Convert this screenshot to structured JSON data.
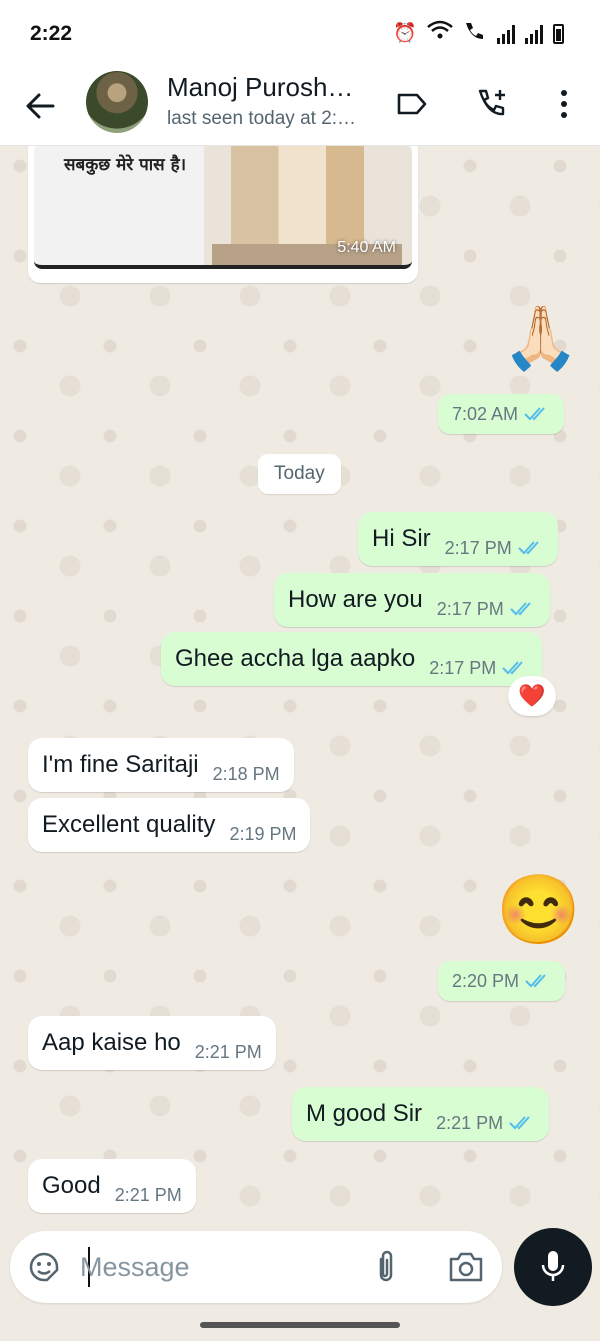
{
  "status_bar": {
    "time": "2:22"
  },
  "header": {
    "contact_name": "Manoj Purosh…",
    "contact_status": "last seen today at 2:…"
  },
  "image_message": {
    "caption": "सबकुछ मेरे पास है।",
    "time": "5:40 AM"
  },
  "messages_before_today": [
    {
      "type": "emoji",
      "emoji": "🙏🏻",
      "time": "7:02 AM",
      "direction": "out",
      "read": true
    }
  ],
  "date_divider": "Today",
  "messages": [
    {
      "direction": "out",
      "text": "Hi Sir",
      "time": "2:17 PM",
      "read": true
    },
    {
      "direction": "out",
      "text": "How are you",
      "time": "2:17 PM",
      "read": true
    },
    {
      "direction": "out",
      "text": "Ghee accha lga aapko",
      "time": "2:17 PM",
      "read": true,
      "reaction": "❤️"
    },
    {
      "direction": "in",
      "text": "I'm fine Saritaji",
      "time": "2:18 PM"
    },
    {
      "direction": "in",
      "text": "Excellent quality",
      "time": "2:19 PM"
    },
    {
      "direction": "out",
      "type": "emoji",
      "emoji": "😊",
      "time": "2:20 PM",
      "read": true
    },
    {
      "direction": "in",
      "text": "Aap kaise ho",
      "time": "2:21 PM"
    },
    {
      "direction": "out",
      "text": "M good Sir",
      "time": "2:21 PM",
      "read": true
    },
    {
      "direction": "in",
      "text": "Good",
      "time": "2:21 PM"
    }
  ],
  "composer": {
    "placeholder": "Message"
  },
  "colors": {
    "outgoing_bubble": "#d9fdd3",
    "incoming_bubble": "#ffffff",
    "read_ticks": "#53bdeb",
    "chat_background": "#efeae2"
  }
}
